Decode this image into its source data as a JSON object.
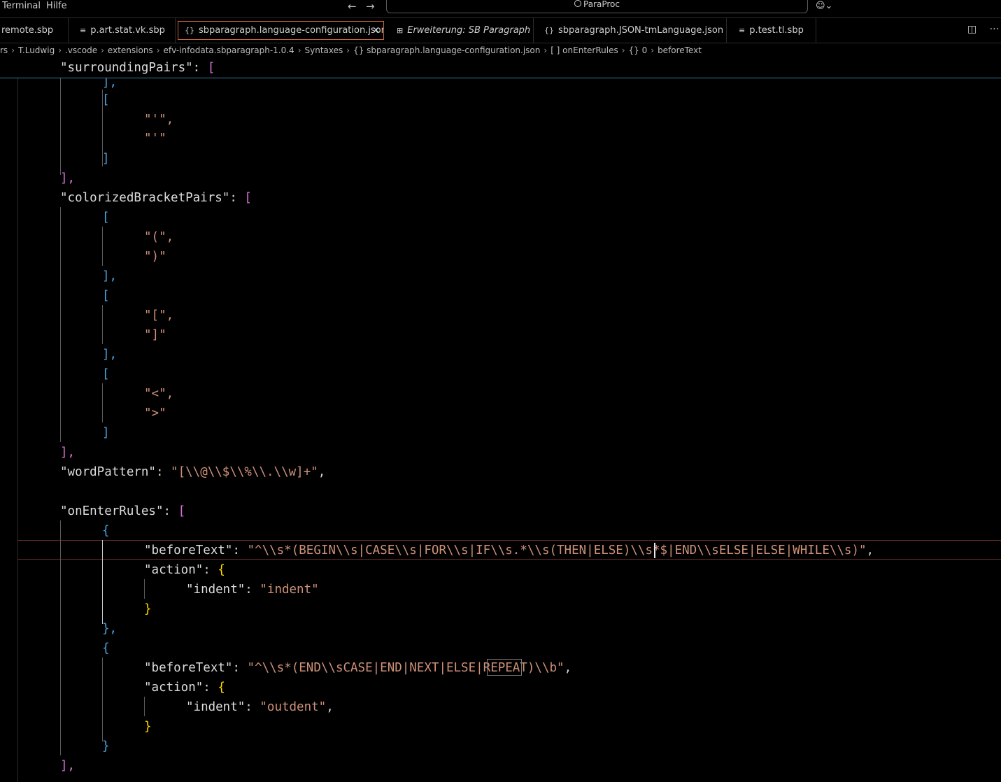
{
  "menu": {
    "terminal": "Terminal",
    "help": "Hilfe"
  },
  "command_center": {
    "label": "ParaProc"
  },
  "tabs": [
    {
      "label": "remote.sbp",
      "icon": "list-icon"
    },
    {
      "label": "p.art.stat.vk.sbp",
      "icon": "list-icon"
    },
    {
      "label": "sbparagraph.language-configuration.json",
      "icon": "{}",
      "active": true
    },
    {
      "label": "Erweiterung: SB Paragraph",
      "icon": "extension-icon",
      "preview": true
    },
    {
      "label": "sbparagraph.JSON-tmLanguage.json",
      "icon": "{}"
    },
    {
      "label": "p.test.tl.sbp",
      "icon": "list-icon"
    }
  ],
  "breadcrumb": [
    "rs",
    "T.Ludwig",
    ".vscode",
    "extensions",
    "efv-infodata.sbparagraph-1.0.4",
    "Syntaxes",
    "{} sbparagraph.language-configuration.json",
    "[ ] onEnterRules",
    "{} 0",
    "beforeText"
  ],
  "code": {
    "l0_key": "\"surroundingPairs\"",
    "l1": "],",
    "l2": "[",
    "l3": "\"'\",",
    "l4": "\"'\"",
    "l5": "]",
    "l6": "],",
    "l7_key": "\"colorizedBracketPairs\"",
    "l8": "[",
    "l9": "\"(\",",
    "l10": "\")\"",
    "l11": "],",
    "l12": "[",
    "l13": "\"[\",",
    "l14": "\"]\"",
    "l15": "],",
    "l16": "[",
    "l17": "\"<\",",
    "l18": "\">\"",
    "l19": "]",
    "l20": "],",
    "l21_key": "\"wordPattern\"",
    "l21_val": "\"[\\\\@\\\\$\\\\%\\\\.\\\\w]+\"",
    "l23_key": "\"onEnterRules\"",
    "l24": "{",
    "l25_key": "\"beforeText\"",
    "l25_val": "\"^\\\\s*(BEGIN\\\\s|CASE\\\\s|FOR\\\\s|IF\\\\s.*\\\\s(THEN|ELSE)\\\\s*$|END\\\\sELSE|ELSE|WHILE\\\\s)\"",
    "l26_key": "\"action\"",
    "l27_key": "\"indent\"",
    "l27_val": "\"indent\"",
    "l28": "}",
    "l29": "},",
    "l30": "{",
    "l31_key": "\"beforeText\"",
    "l31_val": "\"^\\\\s*(END\\\\sCASE|END|NEXT|ELSE|REPEAT)\\\\b\"",
    "l32_key": "\"action\"",
    "l33_key": "\"indent\"",
    "l33_val": "\"outdent\"",
    "l34": "}",
    "l35": "}",
    "l36": "],"
  }
}
